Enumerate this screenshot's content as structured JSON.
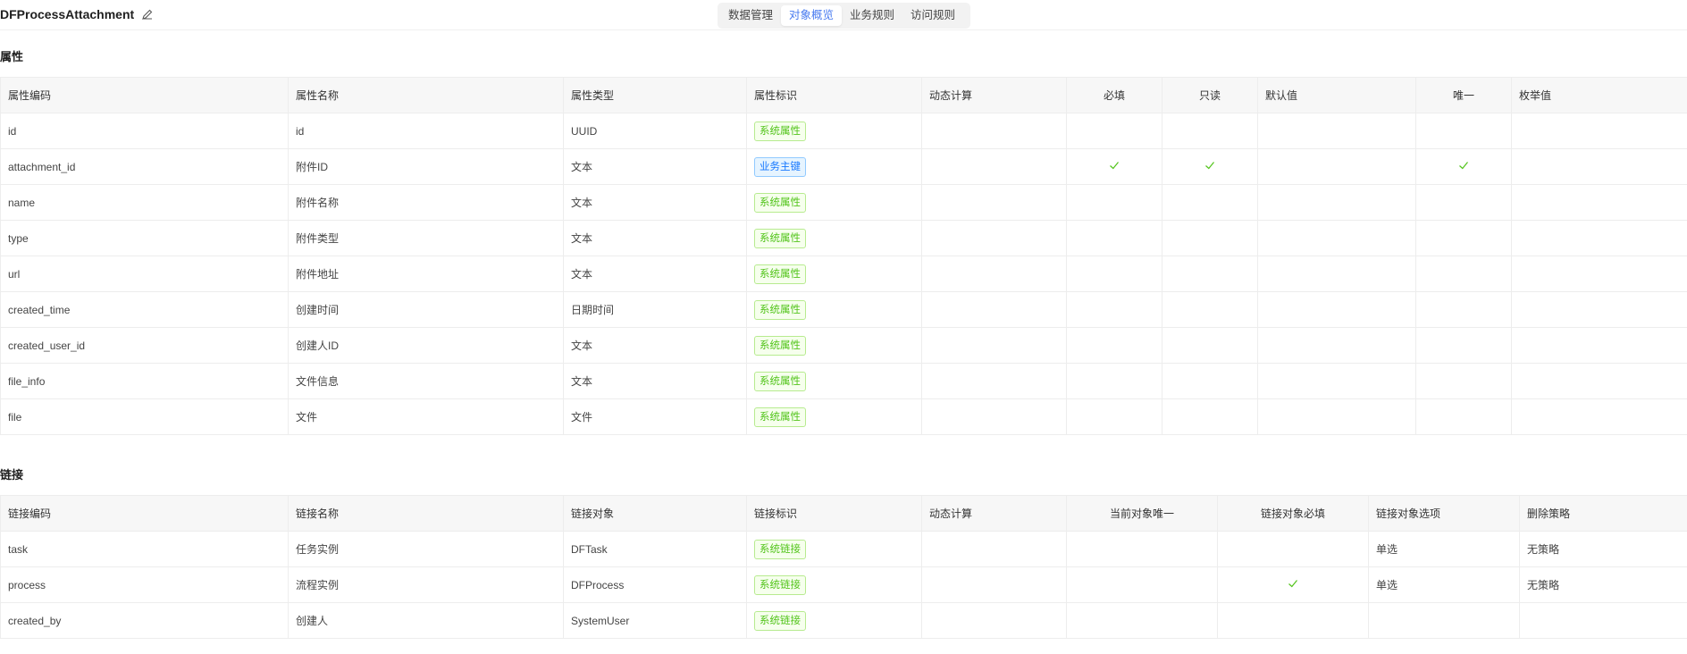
{
  "header": {
    "title": "DFProcessAttachment",
    "tabs": [
      "数据管理",
      "对象概览",
      "业务规则",
      "访问规则"
    ],
    "active_tab": 1
  },
  "colors": {
    "accent": "#4a7cf0",
    "tag_green": "#52c41a",
    "tag_blue": "#1677ff",
    "check": "#52c41a"
  },
  "attributes": {
    "section_title": "属性",
    "columns": [
      "属性编码",
      "属性名称",
      "属性类型",
      "属性标识",
      "动态计算",
      "必填",
      "只读",
      "默认值",
      "唯一",
      "枚举值"
    ],
    "rows": [
      {
        "code": "id",
        "name": "id",
        "type": "UUID",
        "flag": "系统属性",
        "flag_color": "green",
        "required": false,
        "readonly": false,
        "unique": false
      },
      {
        "code": "attachment_id",
        "name": "附件ID",
        "type": "文本",
        "flag": "业务主键",
        "flag_color": "blue",
        "required": true,
        "readonly": true,
        "unique": true
      },
      {
        "code": "name",
        "name": "附件名称",
        "type": "文本",
        "flag": "系统属性",
        "flag_color": "green",
        "required": false,
        "readonly": false,
        "unique": false
      },
      {
        "code": "type",
        "name": "附件类型",
        "type": "文本",
        "flag": "系统属性",
        "flag_color": "green",
        "required": false,
        "readonly": false,
        "unique": false
      },
      {
        "code": "url",
        "name": "附件地址",
        "type": "文本",
        "flag": "系统属性",
        "flag_color": "green",
        "required": false,
        "readonly": false,
        "unique": false
      },
      {
        "code": "created_time",
        "name": "创建时间",
        "type": "日期时间",
        "flag": "系统属性",
        "flag_color": "green",
        "required": false,
        "readonly": false,
        "unique": false
      },
      {
        "code": "created_user_id",
        "name": "创建人ID",
        "type": "文本",
        "flag": "系统属性",
        "flag_color": "green",
        "required": false,
        "readonly": false,
        "unique": false
      },
      {
        "code": "file_info",
        "name": "文件信息",
        "type": "文本",
        "flag": "系统属性",
        "flag_color": "green",
        "required": false,
        "readonly": false,
        "unique": false
      },
      {
        "code": "file",
        "name": "文件",
        "type": "文件",
        "flag": "系统属性",
        "flag_color": "green",
        "required": false,
        "readonly": false,
        "unique": false
      }
    ]
  },
  "links": {
    "section_title": "链接",
    "columns": [
      "链接编码",
      "链接名称",
      "链接对象",
      "链接标识",
      "动态计算",
      "当前对象唯一",
      "链接对象必填",
      "链接对象选项",
      "删除策略"
    ],
    "rows": [
      {
        "code": "task",
        "name": "任务实例",
        "target": "DFTask",
        "flag": "系统链接",
        "current_unique": false,
        "target_required": false,
        "option": "单选",
        "delete_policy": "无策略"
      },
      {
        "code": "process",
        "name": "流程实例",
        "target": "DFProcess",
        "flag": "系统链接",
        "current_unique": false,
        "target_required": true,
        "option": "单选",
        "delete_policy": "无策略"
      },
      {
        "code": "created_by",
        "name": "创建人",
        "target": "SystemUser",
        "flag": "系统链接",
        "current_unique": false,
        "target_required": false,
        "option": "",
        "delete_policy": ""
      }
    ]
  }
}
